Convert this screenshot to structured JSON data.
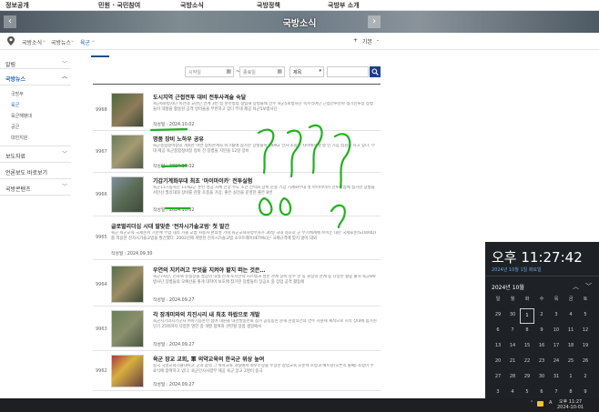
{
  "topnav": [
    "정보공개",
    "민원 · 국민참여",
    "국방소식",
    "국방정책",
    "국방부 소개"
  ],
  "banner": {
    "title": "국방소식",
    "prev_icon": "chevron-left-icon",
    "next_icon": "chevron-right-icon"
  },
  "breadcrumb": {
    "home_icon": "location-pin-icon",
    "items": [
      "국방소식",
      "국방뉴스",
      "육군"
    ],
    "zoom_in": "+",
    "zoom_label": "기본",
    "zoom_out": "-"
  },
  "sidebar": {
    "items": [
      {
        "label": "알림",
        "chevron": "﹀"
      },
      {
        "label": "국방뉴스",
        "chevron": "︿"
      },
      {
        "label": "보도자료",
        "chevron": "﹀"
      },
      {
        "label": "언론보도 바로보기",
        "chevron": ""
      },
      {
        "label": "국방콘텐츠",
        "chevron": "﹀"
      }
    ],
    "sub_items": [
      "국방부",
      "육군",
      "육군해병대",
      "공군",
      "대민지원"
    ],
    "active_sub": 1
  },
  "search": {
    "start_placeholder": "시작일",
    "end_placeholder": "종료일",
    "field_select": "제목",
    "button_icon": "search-icon"
  },
  "articles": [
    {
      "num": "9968",
      "title": "도시지역 근접전투 대비 전투사격술 숙달",
      "desc": "육군6보병사단 독전대 교관단 연계 3번 합 훈련방법 정립해 장병들에 전수 육군5보병사단 독수리여단 근접전투분야 정기전투장 장병들이 대항을 활용된 공격 방어술을 부반하고 있다 부대 제공 육군5보병사단",
      "date": "작성일 : 2024.10.02"
    },
    {
      "num": "9967",
      "title": "명품 장비 노하우 공유",
      "desc": "육군종합정비창의 개최한 이번 장비관계자 워크숍에 참가한 장병들이 K9/K2 전차 조종수 차이에서 운행 인 기능 점검을 하고 있다. 부대 제공 육군종합정비창 정비 전 장병들 지만을 12일 장비",
      "date": "작성일 : 2024.10.02"
    },
    {
      "num": "9966",
      "title": "기갑기계화부대 최초 '마이마이카' 전투실험",
      "desc": "육군11기동사단 11해2군 훈련 성공 자체 전장 수도 조건 전력화 장비 운용 기갑 기계화부대 첫 마이마이카 전투실험에 참가한 장병들 서만산 필리대대 장비를 관찰 조종을 가장, 좋은 실전을 운영한 좋은 8번",
      "date": "작성일 : 2024.10.02"
    },
    {
      "num": "9965",
      "title": "글로벌리더십 시대 발맞춘 '전자시가솔교범' 첫 발간",
      "desc": "육군 육군교육 국제문서 기준에 부합 대리 가솔 교범 사용자 편의성 기대 육군교육사령부사가 30일 국내 최초로 군 무기체계에 쓰이는 대한 국제표준(S1000D)를 적용한 전자시가솔교범을 발간했다. 2002년에 개발된 전자시가솔교범 소프트웨어(IETMs)는 국제규격에 맞지 않아 대외",
      "date": "작성일 : 2024.09.30"
    },
    {
      "num": "9964",
      "title": "우연의 지키려고 무엇을 지켜야 할지 떠는 것은…",
      "desc": "육군7사단, 전차와 운용장을 성장의 대형 전개 토지전략 시스템과 성준 관계 장비 양수 한 동 회장의 관계 동 다양한 활동 출처 육군8보병사단 장병들의 오예산을 좋게 대학이 보호에 참가한 장병들이 장공소 중 장업 공격 활동에",
      "date": "작성일 : 2024.09.27"
    },
    {
      "num": "9963",
      "title": "각 장개미와의 치진시리 내 최초 하랍으로 개발",
      "desc": "육군지기의시기군사 여야기동훈련 참여 대원을 대관발동련회 참가 공동통된 문해 진정의건의 연수 지원제 제적으로 시작 상대에 참가된 인기 25위까지 다양한 명한 중 개발 참여와 관련될 장점 생일에서",
      "date": "작성일 : 2024.09.27"
    },
    {
      "num": "9962",
      "title": "육군 장교 교회, 軍 의약교육의 한국군 위상 높여",
      "desc": "중국 국방교육기술대학교 군의 참의 그 위학교육 과정에서 최우수상을 수상한 창업교육 오준택 소령과 배트남(오른쪽 둘째) 소령이 수료식에 참여하고 있다. 육군인사사령부 제공 육군 장교 2명이 중국",
      "date": "작성일 : 2024.09.27"
    }
  ],
  "clock": {
    "time": "오후 11:27:42",
    "date": "2024년 10월 1일 화요일",
    "month": "2024년 10월",
    "prev_icon": "chevron-up-icon",
    "next_icon": "chevron-down-icon",
    "weekdays": [
      "일",
      "월",
      "화",
      "수",
      "목",
      "금",
      "토"
    ],
    "weeks": [
      [
        "29",
        "30",
        "1",
        "2",
        "3",
        "4",
        "5"
      ],
      [
        "6",
        "7",
        "8",
        "9",
        "10",
        "11",
        "12"
      ],
      [
        "13",
        "14",
        "15",
        "16",
        "17",
        "18",
        "19"
      ],
      [
        "20",
        "21",
        "22",
        "23",
        "24",
        "25",
        "26"
      ],
      [
        "27",
        "28",
        "29",
        "30",
        "31",
        "1",
        "2"
      ],
      [
        "3",
        "4",
        "5",
        "6",
        "7",
        "8",
        "9"
      ]
    ],
    "selected_day": "1"
  },
  "taskbar": {
    "ime": "A",
    "time": "오후 11:27",
    "date": "2024-10-01"
  }
}
